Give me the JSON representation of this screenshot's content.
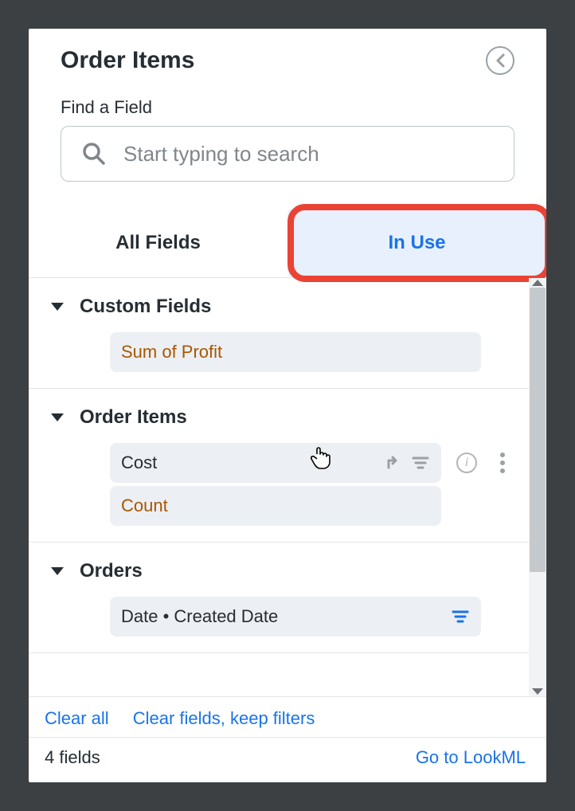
{
  "header": {
    "title": "Order Items"
  },
  "search": {
    "label": "Find a Field",
    "placeholder": "Start typing to search"
  },
  "tabs": {
    "all_fields": "All Fields",
    "in_use": "In Use"
  },
  "groups": {
    "custom_fields": {
      "title": "Custom Fields",
      "sum_of_profit": "Sum of Profit"
    },
    "order_items": {
      "title": "Order Items",
      "cost": "Cost",
      "count": "Count"
    },
    "orders": {
      "title": "Orders",
      "date_created": "Date • Created Date"
    }
  },
  "footer": {
    "clear_all": "Clear all",
    "clear_fields_keep_filters": "Clear fields, keep filters",
    "field_count": "4 fields",
    "go_to_lookml": "Go to LookML"
  }
}
